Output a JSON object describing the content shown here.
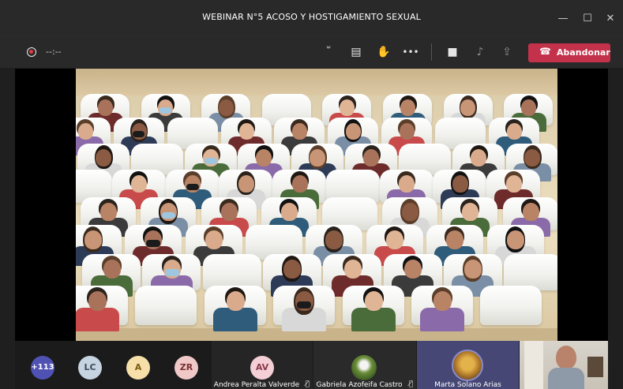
{
  "window": {
    "title": "WEBINAR N°5 ACOSO Y HOSTIGAMIENTO SEXUAL",
    "controls": {
      "minimize": "—",
      "maximize": "☐",
      "close": "✕"
    }
  },
  "toolbar": {
    "timer": "--:--",
    "icons": {
      "participants": "participants-icon",
      "chat": "chat-icon",
      "raise_hand": "raise-hand-icon",
      "more": "more-icon",
      "camera": "camera-icon",
      "mic": "mic-icon",
      "share": "share-icon"
    },
    "glyphs": {
      "participants": "ꙻ",
      "chat": "▤",
      "raise_hand": "✋",
      "more": "•••",
      "camera": "■",
      "mic": "♪",
      "share": "⇪",
      "phone": "☎"
    },
    "leave_label": "Abandonar",
    "leave_color": "#c4314b"
  },
  "participants_strip": {
    "overflow": {
      "label": "+113",
      "color": "#4f52b2"
    },
    "avatars": [
      {
        "initials": "LC",
        "bg": "#c6d3e0",
        "fg": "#3b4a5a"
      },
      {
        "initials": "A",
        "bg": "#f6dfa8",
        "fg": "#7a5a10"
      },
      {
        "initials": "ZR",
        "bg": "#f0c8c8",
        "fg": "#7a3030"
      }
    ],
    "tiles": [
      {
        "initials": "AV",
        "name": "Andrea Peralta Valverde",
        "bg": "#f4cfd6",
        "fg": "#8a3a4a"
      },
      {
        "name": "Gabriela Azofeifa Castro"
      },
      {
        "name": "Marta Solano Arias"
      }
    ],
    "mic_off_glyph": "🎙̸"
  }
}
